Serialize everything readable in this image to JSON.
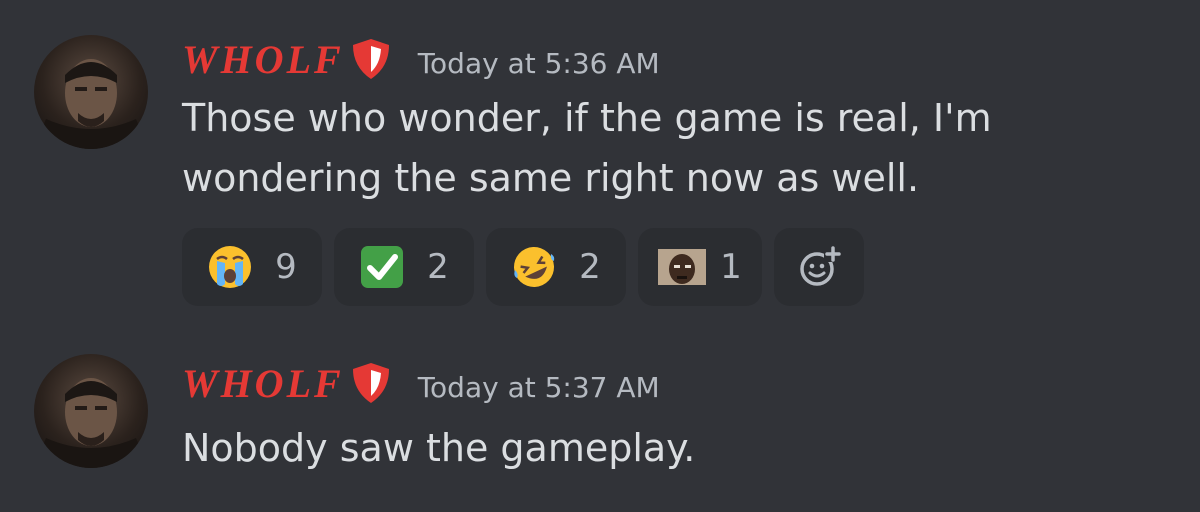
{
  "messages": [
    {
      "username": "WHOLF",
      "timestamp": "Today at 5:36 AM",
      "lines": [
        "Those who wonder, if the game is real, I'm",
        "wondering the same right now as well."
      ],
      "reactions": [
        {
          "icon": "crying-face-emoji",
          "count": "9"
        },
        {
          "icon": "check-mark-emoji",
          "count": "2"
        },
        {
          "icon": "rolling-laughing-emoji",
          "count": "2"
        },
        {
          "icon": "custom-face-emoji",
          "count": "1"
        }
      ],
      "add_reaction_icon": "add-reaction-icon"
    },
    {
      "username": "WHOLF",
      "timestamp": "Today at 5:37 AM",
      "lines": [
        "Nobody saw the gameplay."
      ]
    }
  ],
  "colors": {
    "background": "#313338",
    "username": "#e53935",
    "timestamp": "#b5bac1",
    "text": "#dbdee1",
    "reaction_bg": "#2b2d31"
  }
}
